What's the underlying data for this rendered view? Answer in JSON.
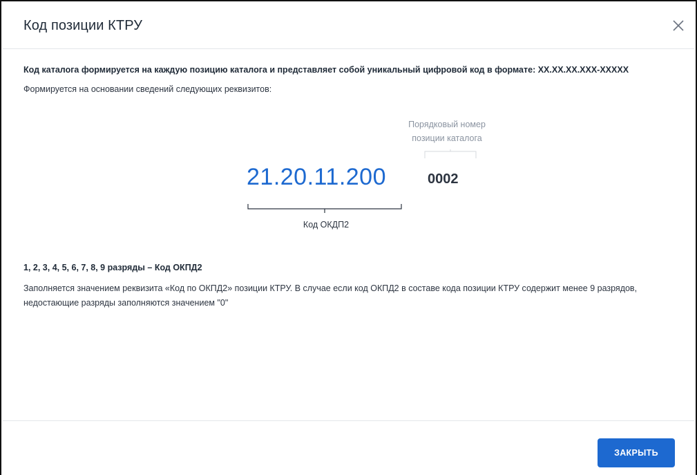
{
  "dialog": {
    "title": "Код позиции КТРУ"
  },
  "intro": {
    "lead": "Код каталога формируется на каждую позицию каталога и представляет собой уникальный цифровой код в формате: XX.XX.XX.XXX-XXXXX",
    "sub": "Формируется на основании сведений следующих реквизитов:"
  },
  "diagram": {
    "position_label": "Порядковый номер позиции каталога",
    "okpd_code": "21.20.11.200",
    "position_code": "0002",
    "okpd_label": "Код ОКДП2"
  },
  "section": {
    "title": "1, 2, 3, 4, 5, 6, 7, 8, 9 разряды – Код ОКПД2",
    "text": "Заполняется значением реквизита «Код по ОКПД2» позиции КТРУ. В случае если код ОКПД2 в составе кода позиции КТРУ содержит менее 9 разрядов, недостающие разряды заполняются значением \"0\""
  },
  "footer": {
    "close_label": "ЗАКРЫТЬ"
  },
  "colors": {
    "accent": "#1d69d0",
    "muted": "#8a93a0",
    "text": "#1f2a37"
  },
  "icons": {
    "close": "close-icon"
  }
}
